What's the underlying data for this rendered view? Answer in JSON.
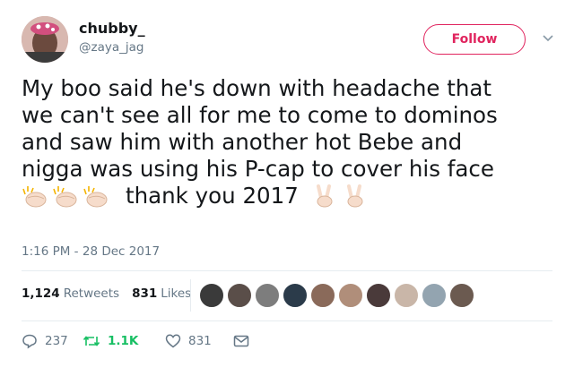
{
  "author": {
    "name": "chubby_",
    "handle": "@zaya_jag"
  },
  "follow_label": "Follow",
  "tweet": {
    "lines": [
      "My boo said he's down with headache that",
      "we can't see all for me to come to dominos",
      "and saw him with another hot Bebe and",
      "nigga was using his P-cap to cover his face"
    ],
    "emoji_line_text": "thank you 2017",
    "emojis_before": [
      "clapping-hands-icon",
      "clapping-hands-icon",
      "clapping-hands-icon"
    ],
    "emojis_after": [
      "victory-hand-icon",
      "victory-hand-icon"
    ]
  },
  "timestamp": "1:16 PM - 28 Dec 2017",
  "stats": {
    "retweets_count": "1,124",
    "retweets_label": "Retweets",
    "likes_count": "831",
    "likes_label": "Likes"
  },
  "likers": [
    "#3a3a3a",
    "#5a4e49",
    "#7d7d7d",
    "#2b3b4a",
    "#8a6a5a",
    "#b08e7a",
    "#4a3a3a",
    "#c9b6a8",
    "#93a4b0",
    "#6b5a50"
  ],
  "actions": {
    "reply_count": "237",
    "retweet_count": "1.1K",
    "like_count": "831"
  },
  "colors": {
    "follow": "#e0245e",
    "retweet_green": "#17bf63",
    "secondary_text": "#657786"
  }
}
